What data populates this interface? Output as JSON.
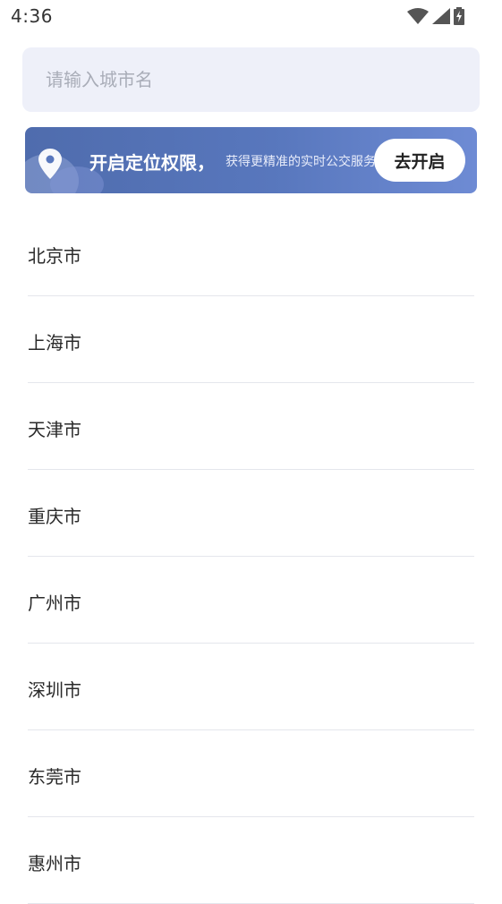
{
  "status_bar": {
    "time": "4:36",
    "icons": [
      "wifi-icon",
      "signal-icon",
      "battery-charging-icon"
    ]
  },
  "search": {
    "placeholder": "请输入城市名",
    "value": ""
  },
  "location_banner": {
    "title": "开启定位权限，",
    "subtitle": "获得更精准的实时公交服务",
    "button_label": "去开启",
    "icon": "location-pin-icon",
    "accent_color": "#5877bd"
  },
  "cities": [
    {
      "label": "北京市"
    },
    {
      "label": "上海市"
    },
    {
      "label": "天津市"
    },
    {
      "label": "重庆市"
    },
    {
      "label": "广州市"
    },
    {
      "label": "深圳市"
    },
    {
      "label": "东莞市"
    },
    {
      "label": "惠州市"
    }
  ]
}
